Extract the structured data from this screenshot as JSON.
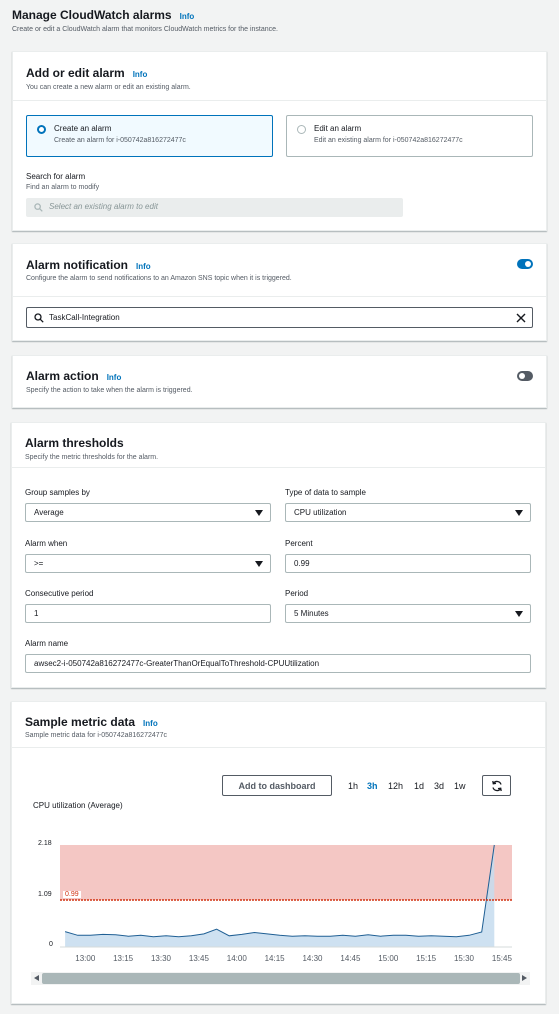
{
  "header": {
    "title": "Manage CloudWatch alarms",
    "info": "Info",
    "description": "Create or edit a CloudWatch alarm that monitors CloudWatch metrics for the instance."
  },
  "add_edit": {
    "title": "Add or edit alarm",
    "info": "Info",
    "description": "You can create a new alarm or edit an existing alarm.",
    "option_create": {
      "label": "Create an alarm",
      "desc": "Create an alarm for i-050742a816272477c",
      "selected": true
    },
    "option_edit": {
      "label": "Edit an alarm",
      "desc": "Edit an existing alarm for i-050742a816272477c",
      "selected": false
    },
    "search_label": "Search for alarm",
    "search_desc": "Find an alarm to modify",
    "search_placeholder": "Select an existing alarm to edit"
  },
  "notification": {
    "title": "Alarm notification",
    "info": "Info",
    "description": "Configure the alarm to send notifications to an Amazon SNS topic when it is triggered.",
    "enabled": true,
    "topic_value": "TaskCall-Integration"
  },
  "action": {
    "title": "Alarm action",
    "info": "Info",
    "description": "Specify the action to take when the alarm is triggered.",
    "enabled": false
  },
  "thresholds": {
    "title": "Alarm thresholds",
    "description": "Specify the metric thresholds for the alarm.",
    "group_label": "Group samples by",
    "group_value": "Average",
    "type_label": "Type of data to sample",
    "type_value": "CPU utilization",
    "when_label": "Alarm when",
    "when_value": ">=",
    "percent_label": "Percent",
    "percent_value": "0.99",
    "consecutive_label": "Consecutive period",
    "consecutive_value": "1",
    "period_label": "Period",
    "period_value": "5 Minutes",
    "name_label": "Alarm name",
    "name_value": "awsec2-i-050742a816272477c-GreaterThanOrEqualToThreshold-CPUUtilization"
  },
  "sample": {
    "title": "Sample metric data",
    "info": "Info",
    "description": "Sample metric data for i-050742a816272477c",
    "add_button": "Add to dashboard",
    "ranges": [
      "1h",
      "3h",
      "12h",
      "1d",
      "3d",
      "1w"
    ],
    "active_range": "3h",
    "refresh_icon": "refresh-icon"
  },
  "colors": {
    "accent": "#0073bb",
    "alarm_zone": "#f4c7c4",
    "threshold": "#d13212",
    "series_fill": "#c5dcef",
    "series_line": "#1f5f94"
  },
  "chart_data": {
    "type": "area",
    "title": "CPU utilization (Average)",
    "xlabel": "",
    "ylabel": "",
    "ylim": [
      0,
      2.18
    ],
    "yticks": [
      "2.18",
      "1.09",
      "0"
    ],
    "xticks": [
      "13:00",
      "13:15",
      "13:30",
      "13:45",
      "14:00",
      "14:15",
      "14:30",
      "14:45",
      "15:00",
      "15:15",
      "15:30",
      "15:45"
    ],
    "threshold": {
      "value": 0.99,
      "label": "0.99"
    },
    "series": [
      {
        "x": [
          "12:52",
          "12:57",
          "13:02",
          "13:07",
          "13:12",
          "13:17",
          "13:22",
          "13:27",
          "13:32",
          "13:37",
          "13:42",
          "13:47",
          "13:52",
          "13:57",
          "14:02",
          "14:07",
          "14:12",
          "14:17",
          "14:22",
          "14:27",
          "14:32",
          "14:37",
          "14:42",
          "14:47",
          "14:52",
          "14:57",
          "15:02",
          "15:07",
          "15:12",
          "15:17",
          "15:22",
          "15:27",
          "15:32",
          "15:37",
          "15:42"
        ],
        "values": [
          0.33,
          0.25,
          0.25,
          0.27,
          0.26,
          0.23,
          0.25,
          0.22,
          0.24,
          0.22,
          0.24,
          0.28,
          0.38,
          0.24,
          0.27,
          0.31,
          0.28,
          0.25,
          0.23,
          0.24,
          0.23,
          0.23,
          0.25,
          0.23,
          0.26,
          0.23,
          0.25,
          0.25,
          0.23,
          0.24,
          0.23,
          0.22,
          0.25,
          0.32,
          2.18
        ]
      }
    ],
    "grid": false
  }
}
